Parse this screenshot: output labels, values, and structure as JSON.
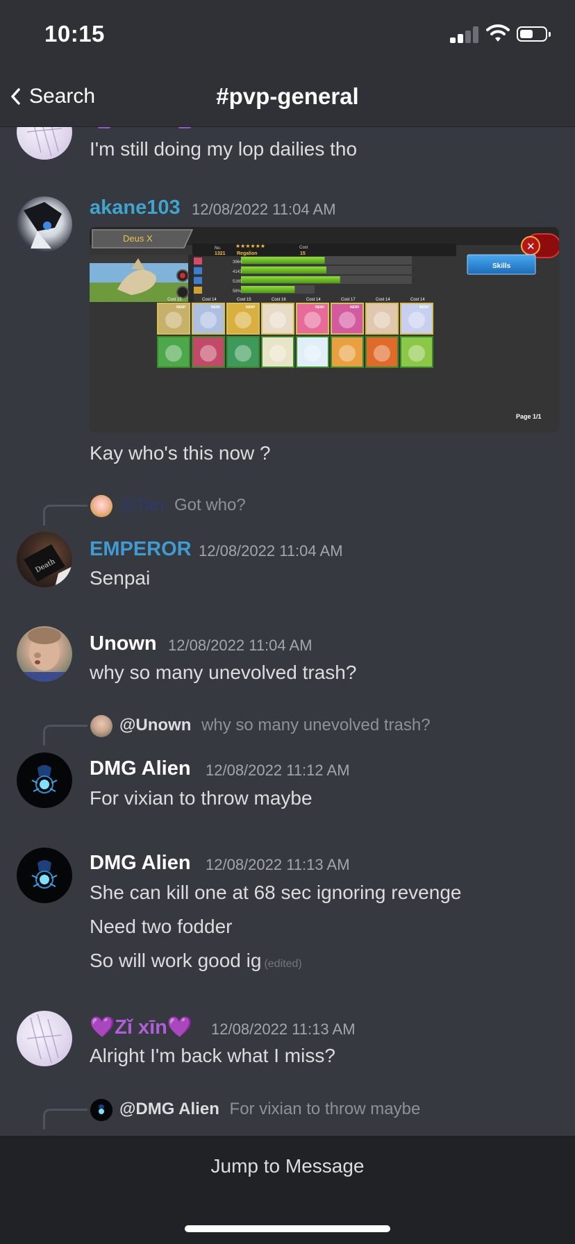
{
  "status_bar": {
    "time": "10:15"
  },
  "nav": {
    "back_label": "Search",
    "channel": "#pvp-general"
  },
  "messages": {
    "m0": {
      "text": "I'm still doing my lop dailies tho"
    },
    "m1": {
      "username": "akane103",
      "username_color": "#3fa4ce",
      "timestamp": "12/08/2022 11:04 AM",
      "embed": {
        "card_name": "Deus X",
        "no_label": "No.",
        "no_value": "1321",
        "stars": "★★★★★★",
        "cost_label": "Cost",
        "cost_value": "15",
        "monster_name": "Regalion",
        "stat_values": [
          "3964",
          "4143",
          "5165",
          "58%"
        ],
        "stat_fills": [
          0.49,
          0.5,
          0.58,
          0.46
        ],
        "skills_label": "Skills",
        "close_label": "✕",
        "card_costs": [
          "Cost 15",
          "Cost 14",
          "Cost 15",
          "Cost 16",
          "Cost 14",
          "Cost 17",
          "Cost 14",
          "Cost 14"
        ],
        "new_badge": "NEW!",
        "page_label": "Page 1/1"
      },
      "text": "Kay who's this now ?"
    },
    "r2": {
      "name": "@Tan",
      "name_color": "#2e3b66",
      "text": "Got who?"
    },
    "m2": {
      "username": "EMPEROR",
      "username_color": "#3f9bd0",
      "timestamp": "12/08/2022 11:04 AM",
      "text": "Senpai"
    },
    "m3": {
      "username": "Unown",
      "username_color": "#ffffff",
      "timestamp": "12/08/2022 11:04 AM",
      "text": "why so many unevolved trash?"
    },
    "r4": {
      "name": "@Unown",
      "name_color": "#dcddde",
      "text": "why so many unevolved trash?"
    },
    "m4": {
      "username": "DMG Alien",
      "username_color": "#ffffff",
      "timestamp": "12/08/2022 11:12 AM",
      "text": "For vixian to throw maybe"
    },
    "m5": {
      "username": "DMG Alien",
      "username_color": "#ffffff",
      "timestamp": "12/08/2022 11:13 AM",
      "lines": [
        "She can kill one at 68 sec ignoring revenge",
        "Need two fodder",
        "So will work good ig"
      ],
      "edited": "(edited)"
    },
    "m6": {
      "username": "💜Zǐ xīn💜",
      "username_color": "#b05fd8",
      "timestamp": "12/08/2022 11:13 AM",
      "text": "Alright I'm back what I miss?"
    },
    "r7": {
      "name": "@DMG Alien",
      "name_color": "#dcddde",
      "text": "For vixian to throw maybe"
    }
  },
  "jump_label": "Jump to Message",
  "colors": {
    "background": "#36393f",
    "header": "#2f3136",
    "bottom_bar": "#202225"
  }
}
